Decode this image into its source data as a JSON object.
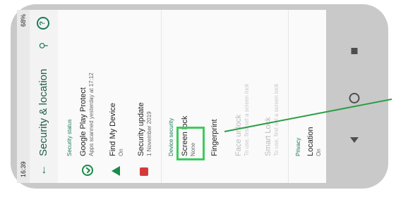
{
  "status_bar": {
    "time": "16:39",
    "battery": "68%"
  },
  "toolbar": {
    "title": "Security & location",
    "back_icon": "arrow-back-icon",
    "search_icon": "search-icon",
    "help_icon": "help-icon"
  },
  "sections": {
    "security_status": {
      "header": "Security status",
      "items": [
        {
          "title": "Google Play Protect",
          "subtitle": "Apps scanned yesterday at 17:12",
          "icon": "shield-check-icon"
        },
        {
          "title": "Find My Device",
          "subtitle": "On",
          "icon": "location-arrow-icon"
        },
        {
          "title": "Security update",
          "subtitle": "1 November 2019",
          "icon": "update-badge-icon"
        }
      ]
    },
    "device_security": {
      "header": "Device security",
      "items": [
        {
          "title": "Screen lock",
          "subtitle": "None"
        },
        {
          "title": "Fingerprint",
          "subtitle": ""
        },
        {
          "title": "Face unlock",
          "subtitle": "To use, first set a screen lock"
        },
        {
          "title": "Smart Lock",
          "subtitle": "To use, first set a screen lock"
        }
      ]
    },
    "privacy": {
      "header": "Privacy",
      "items": [
        {
          "title": "Location",
          "subtitle": "On"
        }
      ]
    }
  },
  "colors": {
    "accent": "#1b7a58",
    "highlight": "#3ecb5c",
    "pointer_line": "#2e9e46"
  }
}
